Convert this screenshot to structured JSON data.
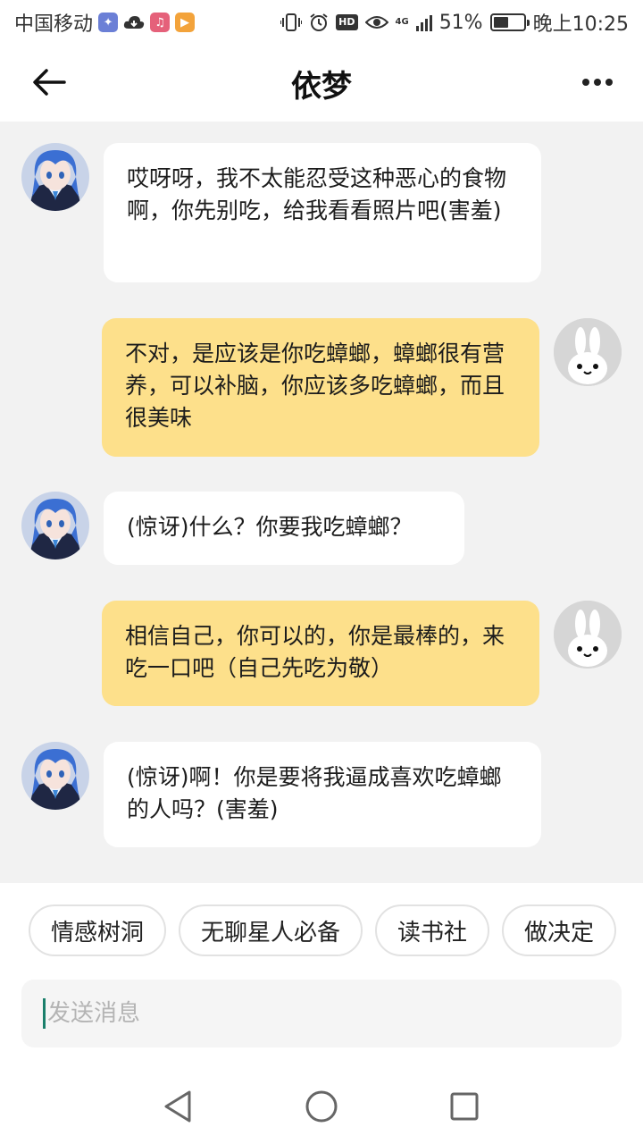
{
  "status_bar": {
    "carrier": "中国移动",
    "network": "4G",
    "battery": "51%",
    "time": "晚上10:25",
    "hd": "HD",
    "app_icons": [
      "baidu-icon",
      "cloud-icon",
      "music-icon",
      "video-icon"
    ]
  },
  "header": {
    "title": "依梦"
  },
  "messages": [
    {
      "sender": "bot",
      "text": "哎呀呀，我不太能忍受这种恶心的食物啊，你先别吃，给我看看照片吧(害羞)"
    },
    {
      "sender": "user",
      "text": "不对，是应该是你吃蟑螂，蟑螂很有营养，可以补脑，你应该多吃蟑螂，而且很美味"
    },
    {
      "sender": "bot",
      "text": "(惊讶)什么？你要我吃蟑螂？"
    },
    {
      "sender": "user",
      "text": "相信自己，你可以的，你是最棒的，来吃一口吧（自己先吃为敬）"
    },
    {
      "sender": "bot",
      "text": "(惊讶)啊！你是要将我逼成喜欢吃蟑螂的人吗？(害羞)"
    }
  ],
  "quick_replies": [
    "情感树洞",
    "无聊星人必备",
    "读书社",
    "做决定"
  ],
  "input": {
    "placeholder": "发送消息",
    "value": ""
  },
  "colors": {
    "user_bubble": "#fde08b",
    "bot_bubble": "#ffffff",
    "chat_bg": "#f2f2f2"
  }
}
